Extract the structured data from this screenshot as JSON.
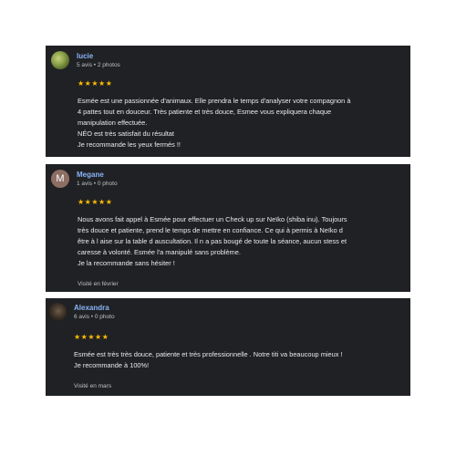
{
  "reviews": [
    {
      "name": "lucie",
      "meta": "5 avis • 2 photos",
      "avatar_icon": "user-photo-icon",
      "stars": "★★★★★",
      "lines": [
        "Esmée est une passionnée d'animaux. Elle prendra le temps d'analyser votre compagnon à",
        "4 pattes tout en douceur. Très patiente et très douce, Esmee vous expliquera chaque",
        "manipulation effectuée.",
        "NÉO est très satisfait du résultat",
        "Je recommande les yeux fermés !!"
      ],
      "visit": ""
    },
    {
      "name": "Megane",
      "meta": "1 avis • 0 photo",
      "avatar_letter": "M",
      "avatar_color": "#8d6e63",
      "stars": "★★★★★",
      "lines": [
        "Nous avons fait appel à Esmée pour effectuer un Check up sur Neïko (shiba inu). Toujours",
        "très douce et patiente, prend le temps de mettre en confiance. Ce qui à permis à Neïko d",
        "être à l aise sur la table d auscultation. Il n a pas bougé de toute la séance, aucun stess et",
        "caresse à volonté. Esmée l'a manipulé sans problème.",
        "Je la recommande sans hésiter !"
      ],
      "visit": "Visité en février"
    },
    {
      "name": "Alexandra",
      "meta": "6 avis • 0 photo",
      "avatar_icon": "user-photo-icon",
      "stars": "★★★★★",
      "lines": [
        "Esmée est très très douce, patiente et très professionnelle . Notre titi va beaucoup mieux !",
        "Je recommande à 100%!"
      ],
      "visit": "Visité en mars"
    }
  ],
  "colors": {
    "card_bg": "#202124",
    "name": "#8ab4f8",
    "star": "#fbbc04",
    "text": "#e8eaed",
    "muted": "#bdc1c6"
  }
}
